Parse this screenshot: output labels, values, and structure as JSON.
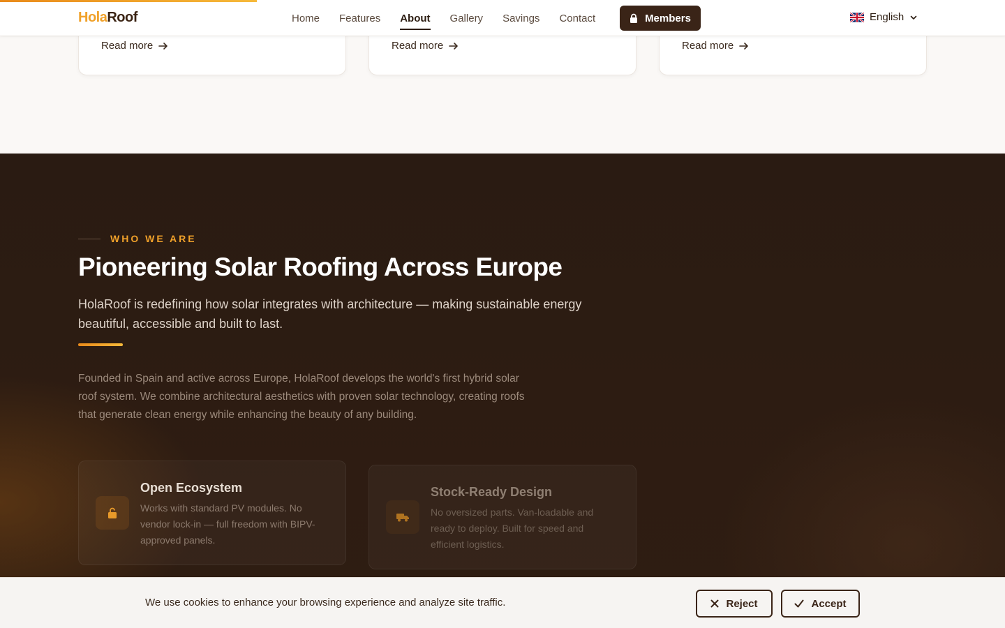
{
  "header": {
    "logo_part1": "Hola",
    "logo_part2": "Roof",
    "nav": [
      {
        "label": "Home"
      },
      {
        "label": "Features"
      },
      {
        "label": "About",
        "active": true
      },
      {
        "label": "Gallery"
      },
      {
        "label": "Savings"
      },
      {
        "label": "Contact"
      }
    ],
    "members_label": "Members",
    "members_icon": "lock-icon",
    "language_label": "English",
    "language_flag": "uk-flag-icon"
  },
  "cards": [
    {
      "readmore": "Read more"
    },
    {
      "readmore": "Read more"
    },
    {
      "readmore": "Read more"
    }
  ],
  "about": {
    "eyebrow": "WHO WE ARE",
    "title": "Pioneering Solar Roofing Across Europe",
    "lead": "HolaRoof is redefining how solar integrates with architecture — making sustainable energy beautiful, accessible and built to last.",
    "body": "Founded in Spain and active across Europe, HolaRoof develops the world's first hybrid solar roof system. We combine architectural aesthetics with proven solar technology, creating roofs that generate clean energy while enhancing the beauty of any building.",
    "features": [
      {
        "title": "Open Ecosystem",
        "text": "Works with standard PV modules. No vendor lock-in — full freedom with BIPV-approved panels.",
        "icon": "unlock-icon"
      },
      {
        "title": "Stock-Ready Design",
        "text": "No oversized parts. Van-loadable and ready to deploy. Built for speed and efficient logistics.",
        "icon": "truck-icon"
      }
    ]
  },
  "cookie": {
    "text": "We use cookies to enhance your browsing experience and analyze site traffic.",
    "reject_label": "Reject",
    "accept_label": "Accept"
  },
  "colors": {
    "accent": "#f0a12a",
    "dark_bg": "#2a1b12",
    "button_dark": "#3a2417"
  }
}
